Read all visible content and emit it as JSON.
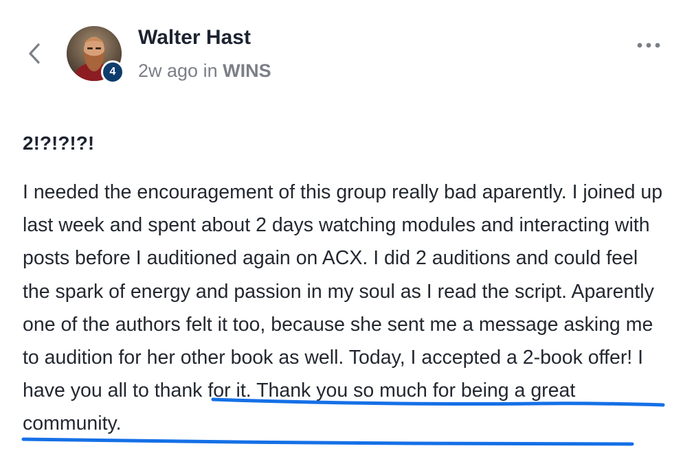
{
  "header": {
    "back_icon": "chevron-left-icon",
    "author_name": "Walter Hast",
    "level": "4",
    "time_ago": "2w ago",
    "in_text": "in",
    "group_name": "WINS",
    "more_icon": "more-horizontal-icon"
  },
  "post": {
    "title": "2!?!?!?!",
    "body_intro": "I needed the encouragement of this group really bad aparently. I joined up last week and spent about 2 days watching modules and interacting with posts before I auditioned again on ACX. I did 2 auditions and could feel the spark of energy and passion in my soul as I read the script. Aparently one of the authors felt it too, because she sent me a message asking me to audition for her other book as well.",
    "body_highlight": "Today, I accepted a 2-book offer! I have you all to thank for it. Thank you so much for being a great community."
  },
  "colors": {
    "badge": "#0e3d6d",
    "underline": "#1570e6",
    "text": "#232830",
    "muted": "#7a7f87"
  }
}
